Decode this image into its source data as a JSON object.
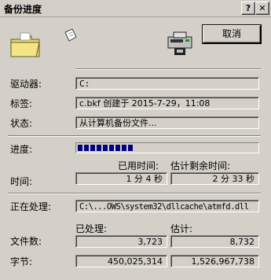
{
  "window": {
    "title": "备份进度",
    "help_button": "?",
    "close_button": "✕"
  },
  "cancel_label": "取消",
  "labels": {
    "drive": "驱动器:",
    "tag": "标签:",
    "status": "状态:",
    "progress": "进度:",
    "time": "时间:",
    "elapsed_header": "已用时间:",
    "remaining_header": "估计剩余时间:",
    "processing": "正在处理:",
    "files": "文件数:",
    "bytes": "字节:",
    "processed_header": "已处理:",
    "estimated_header": "估计:"
  },
  "values": {
    "drive": "C:",
    "tag": "c.bkf 创建于 2015-7-29，11:08",
    "status": "从计算机备份文件...",
    "elapsed": "1 分 4 秒",
    "remaining": "2 分 33 秒",
    "processing": "C:\\...OWS\\system32\\dllcache\\atmfd.dll",
    "files_processed": "3,723",
    "files_estimated": "8,732",
    "bytes_processed": "450,025,314",
    "bytes_estimated": "1,526,967,738"
  },
  "progress_fraction": 0.3,
  "icons": [
    "folder-icon",
    "flying-document-icon",
    "tape-drive-icon"
  ]
}
